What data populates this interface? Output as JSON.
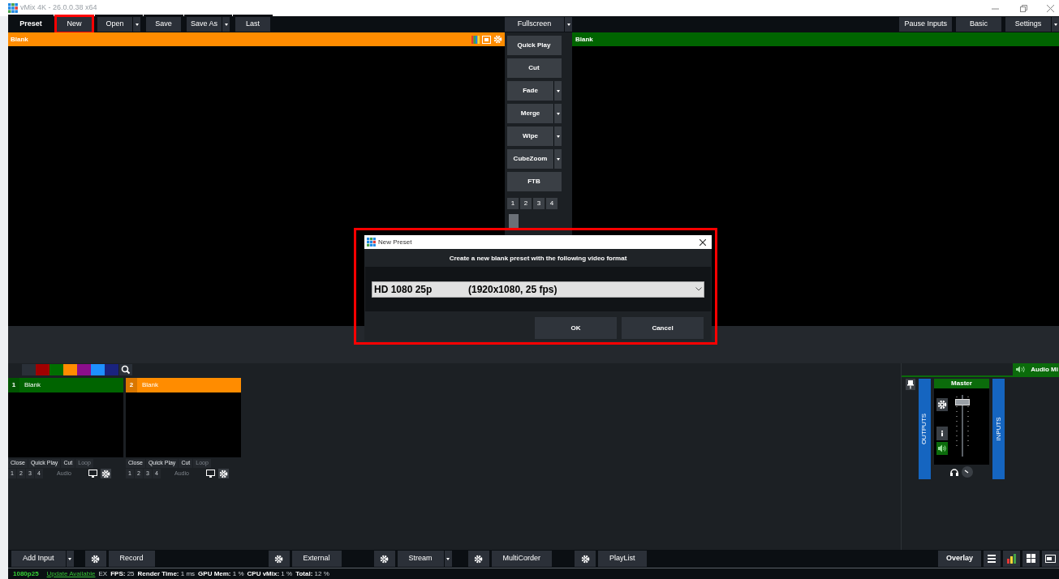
{
  "window": {
    "title": "vMix 4K - 26.0.0.38 x64"
  },
  "toolbar": {
    "left": [
      {
        "label": "Preset",
        "kind": "plain",
        "dropdown": false,
        "highlighted": false
      },
      {
        "label": "New",
        "kind": "button",
        "dropdown": false,
        "highlighted": true
      },
      {
        "label": "Open",
        "kind": "button",
        "dropdown": true,
        "highlighted": false
      },
      {
        "label": "Save",
        "kind": "button",
        "dropdown": false,
        "highlighted": false
      },
      {
        "label": "Save As",
        "kind": "button",
        "dropdown": true,
        "highlighted": false
      },
      {
        "label": "Last",
        "kind": "button",
        "dropdown": false,
        "highlighted": false
      }
    ],
    "center": {
      "label": "Fullscreen",
      "dropdown": true
    },
    "right": [
      {
        "label": "Pause Inputs",
        "dropdown": false
      },
      {
        "label": "Basic",
        "dropdown": false
      },
      {
        "label": "Settings",
        "dropdown": true
      }
    ]
  },
  "preview": {
    "title": "Blank"
  },
  "output": {
    "title": "Blank"
  },
  "transitions": [
    {
      "label": "Quick Play",
      "dropdown": false
    },
    {
      "label": "Cut",
      "dropdown": false
    },
    {
      "label": "Fade",
      "dropdown": true
    },
    {
      "label": "Merge",
      "dropdown": true
    },
    {
      "label": "Wipe",
      "dropdown": true
    },
    {
      "label": "CubeZoom",
      "dropdown": true
    },
    {
      "label": "FTB",
      "dropdown": false
    }
  ],
  "transition_slots": [
    "1",
    "2",
    "3",
    "4"
  ],
  "color_filters": [
    {
      "color": "#2a3038"
    },
    {
      "color": "#a00000"
    },
    {
      "color": "#006e00"
    },
    {
      "color": "#ff8c00"
    },
    {
      "color": "#8b0e8b"
    },
    {
      "color": "#1e90ff"
    },
    {
      "color": "#1a237e"
    }
  ],
  "inputs": [
    {
      "number": "1",
      "title": "Blank",
      "color": "#006400",
      "actions": [
        {
          "label": "Close",
          "disabled": false
        },
        {
          "label": "Quick Play",
          "disabled": false
        },
        {
          "label": "Cut",
          "disabled": false
        },
        {
          "label": "Loop",
          "disabled": true
        }
      ],
      "slots": [
        "1",
        "2",
        "3",
        "4"
      ],
      "audio": {
        "label": "Audio",
        "disabled": true
      }
    },
    {
      "number": "2",
      "title": "Blank",
      "color": "#ff8c00",
      "actions": [
        {
          "label": "Close",
          "disabled": false
        },
        {
          "label": "Quick Play",
          "disabled": false
        },
        {
          "label": "Cut",
          "disabled": false
        },
        {
          "label": "Loop",
          "disabled": true
        }
      ],
      "slots": [
        "1",
        "2",
        "3",
        "4"
      ],
      "audio": {
        "label": "Audio",
        "disabled": true
      }
    }
  ],
  "audio_mixer": {
    "tab": "Audio Mi",
    "outputs_label": "OUTPUTS",
    "inputs_label": "INPUTS",
    "master": {
      "label": "Master",
      "level": 0.9,
      "on": true
    }
  },
  "bottom_bar": {
    "left": [
      {
        "label": "Add Input",
        "settings": false,
        "dropdown": true
      },
      {
        "label": "Record",
        "settings": true,
        "dropdown": false
      },
      {
        "label": "External",
        "settings": true,
        "dropdown": false
      },
      {
        "label": "Stream",
        "settings": true,
        "dropdown": true
      },
      {
        "label": "MultiCorder",
        "settings": true,
        "dropdown": false
      },
      {
        "label": "PlayList",
        "settings": true,
        "dropdown": false
      }
    ],
    "right": {
      "label": "Overlay"
    }
  },
  "status_bar": {
    "format": "1080p25",
    "update": "Update Available",
    "ex": "EX",
    "stats": [
      {
        "label": "FPS:",
        "value": "25"
      },
      {
        "label": "Render Time:",
        "value": "1 ms"
      },
      {
        "label": "GPU Mem:",
        "value": "1 %"
      },
      {
        "label": "CPU vMix:",
        "value": "1 %"
      },
      {
        "label": "Total:",
        "value": "12 %"
      }
    ]
  },
  "dialog": {
    "title": "New Preset",
    "message": "Create a new blank preset with the following video format",
    "format": {
      "name": "HD 1080 25p",
      "detail": "(1920x1080, 25 fps)"
    },
    "buttons": [
      "OK",
      "Cancel"
    ],
    "highlighted": true
  }
}
